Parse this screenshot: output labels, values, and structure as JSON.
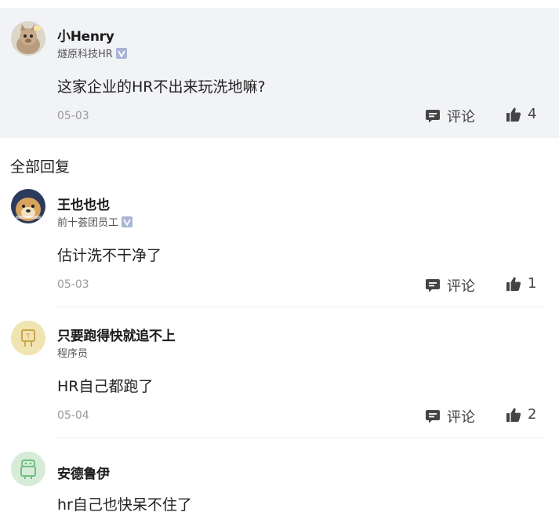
{
  "main_comment": {
    "author": "小Henry",
    "role": "燧原科技HR",
    "text": "这家企业的HR不出来玩洗地嘛?",
    "date": "05-03",
    "comment_label": "评论",
    "likes": "4"
  },
  "section_title": "全部回复",
  "replies": [
    {
      "author": "王也也也",
      "role": "前十荟团员工",
      "verified": true,
      "text": "估计洗不干净了",
      "date": "05-03",
      "comment_label": "评论",
      "likes": "1"
    },
    {
      "author": "只要跑得快就追不上",
      "role": "程序员",
      "verified": false,
      "text": "HR自己都跑了",
      "date": "05-04",
      "comment_label": "评论",
      "likes": "2"
    },
    {
      "author": "安德鲁伊",
      "role": "",
      "verified": false,
      "text": "hr自己也快呆不住了"
    }
  ],
  "colors": {
    "highlight_bg": "#f2f3f6",
    "badge": "#a9b4d6",
    "icon": "#444444"
  }
}
